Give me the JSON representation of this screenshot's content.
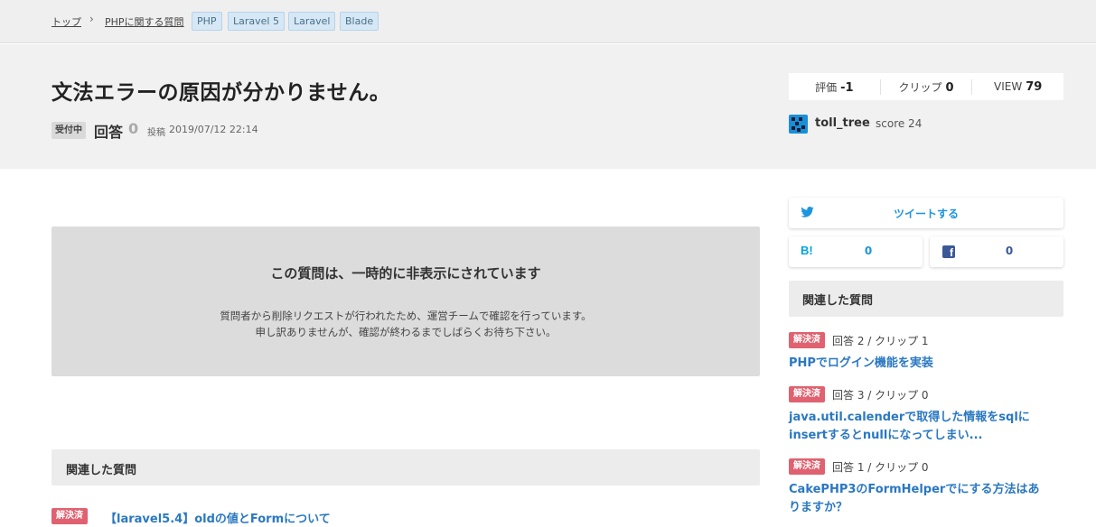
{
  "breadcrumb": {
    "home": "トップ",
    "separator": "›",
    "category": "PHPに関する質問",
    "tags": [
      "PHP",
      "Laravel 5",
      "Laravel",
      "Blade"
    ]
  },
  "question": {
    "title": "文法エラーの原因が分かりません。",
    "status": "受付中",
    "answer_label": "回答",
    "answer_count": "0",
    "posted_label": "投稿",
    "posted_date": "2019/07/12 22:14"
  },
  "stats": {
    "rating_label": "評価",
    "rating_value": "-1",
    "clip_label": "クリップ",
    "clip_value": "0",
    "view_label": "VIEW",
    "view_value": "79"
  },
  "user": {
    "name": "toll_tree",
    "score": "score 24"
  },
  "notice": {
    "title": "この質問は、一時的に非表示にされています",
    "line1": "質問者から削除リクエストが行われたため、運営チームで確認を行っています。",
    "line2": "申し訳ありませんが、確認が終わるまでしばらくお待ち下さい。"
  },
  "share": {
    "tweet_label": "ツイートする",
    "hatena_icon_text": "B!",
    "hatena_count": "0",
    "facebook_count": "0"
  },
  "related_main": {
    "heading": "関連した質問",
    "items": [
      {
        "badge": "解決済",
        "title": "【laravel5.4】oldの値とFormについて"
      }
    ]
  },
  "related_side": {
    "heading": "関連した質問",
    "items": [
      {
        "badge": "解決済",
        "counts": "回答 2 / クリップ 1",
        "title": "PHPでログイン機能を実装"
      },
      {
        "badge": "解決済",
        "counts": "回答 3 / クリップ 0",
        "title": "java.util.calenderで取得した情報をsqlにinsertするとnullになってしまい..."
      },
      {
        "badge": "解決済",
        "counts": "回答 1 / クリップ 0",
        "title": "CakePHP3のFormHelperでにする方法はありますか？"
      }
    ]
  },
  "colors": {
    "link": "#2a78c2",
    "solved_badge": "#e06170",
    "twitter": "#1b95e0",
    "hatena": "#00a4de",
    "facebook": "#3b5998"
  }
}
